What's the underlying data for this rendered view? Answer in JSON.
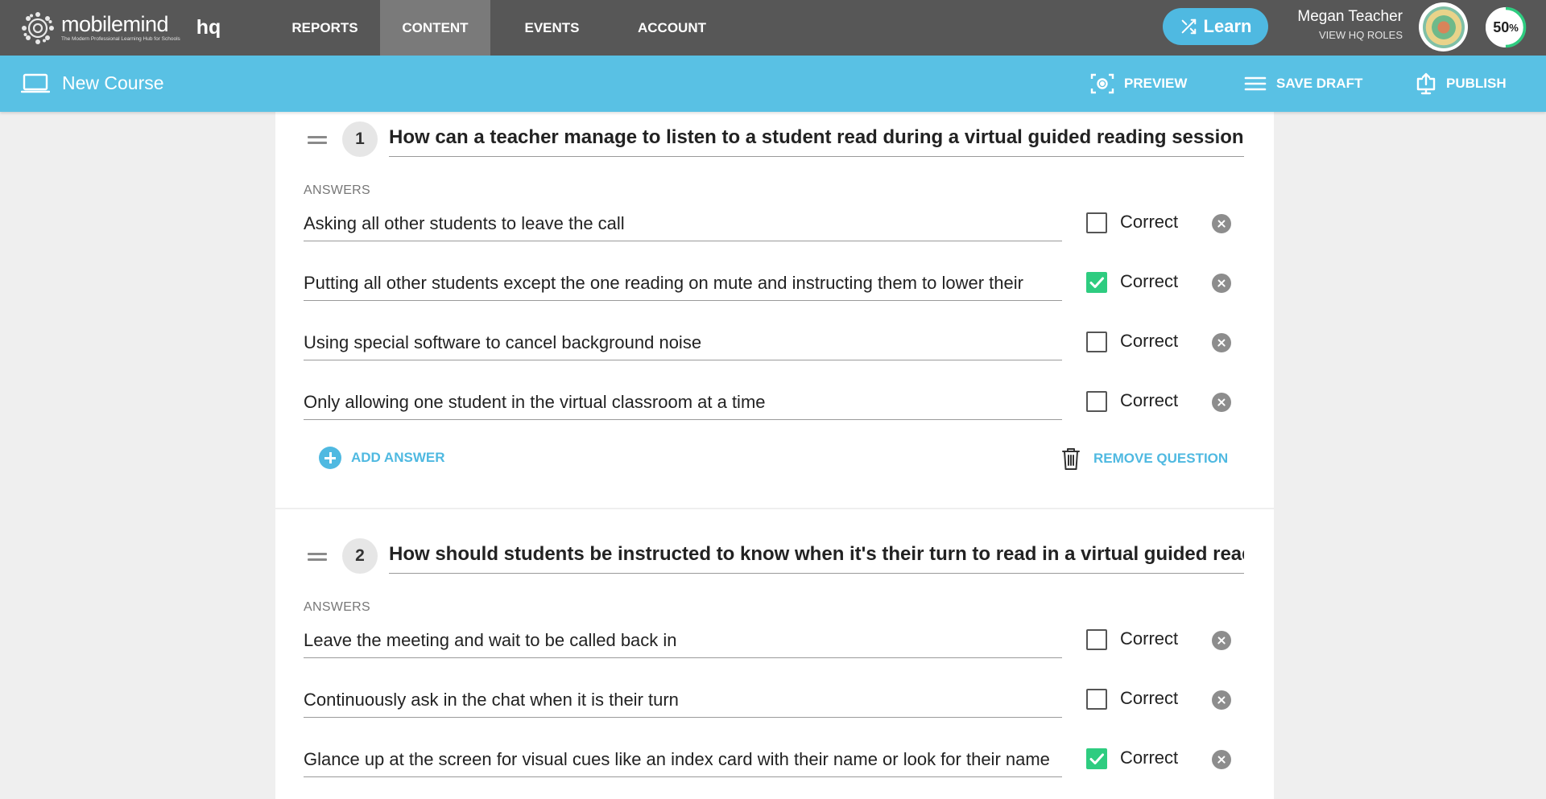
{
  "brand": {
    "name": "mobilemind",
    "tagline": "The Modern Professional Learning Hub for Schools",
    "product": "hq"
  },
  "nav": {
    "items": [
      {
        "label": "REPORTS",
        "active": false
      },
      {
        "label": "CONTENT",
        "active": true
      },
      {
        "label": "EVENTS",
        "active": false
      },
      {
        "label": "ACCOUNT",
        "active": false
      }
    ]
  },
  "header": {
    "learn_label": "Learn",
    "user_name": "Megan Teacher",
    "roles_link": "VIEW HQ ROLES",
    "progress_value": "50",
    "progress_unit": "%",
    "progress_fraction": 0.5
  },
  "course_bar": {
    "title": "New Course",
    "preview_label": "PREVIEW",
    "save_draft_label": "SAVE DRAFT",
    "publish_label": "PUBLISH"
  },
  "questions": [
    {
      "number": "1",
      "text": "How can a teacher manage to listen to a student read during a virtual guided reading session?",
      "answers_label": "ANSWERS",
      "answers": [
        {
          "text": "Asking all other students to leave the call",
          "correct": false,
          "correct_label": "Correct"
        },
        {
          "text": "Putting all other students except the one reading on mute and instructing them to lower their",
          "correct": true,
          "correct_label": "Correct"
        },
        {
          "text": "Using special software to cancel background noise",
          "correct": false,
          "correct_label": "Correct"
        },
        {
          "text": "Only allowing one student in the virtual classroom at a time",
          "correct": false,
          "correct_label": "Correct"
        }
      ],
      "add_answer_label": "ADD ANSWER",
      "remove_question_label": "REMOVE QUESTION"
    },
    {
      "number": "2",
      "text": "How should students be instructed to know when it's their turn to read in a virtual guided reading session?",
      "answers_label": "ANSWERS",
      "answers": [
        {
          "text": "Leave the meeting and wait to be called back in",
          "correct": false,
          "correct_label": "Correct"
        },
        {
          "text": "Continuously ask in the chat when it is their turn",
          "correct": false,
          "correct_label": "Correct"
        },
        {
          "text": "Glance up at the screen for visual cues like an index card with their name or look for their name",
          "correct": true,
          "correct_label": "Correct"
        }
      ]
    }
  ],
  "colors": {
    "topnav_bg": "#575757",
    "nav_active_bg": "#7a7a7a",
    "accent_blue": "#59c1e4",
    "button_blue": "#4fb9e1",
    "check_green": "#2ecc80",
    "page_bg": "#efefef"
  },
  "icons": {
    "logo": "mobilemind-gear-logo",
    "learn": "shuffle-icon",
    "course": "laptop-icon",
    "preview": "eye-scan-icon",
    "save_draft": "menu-lines-icon",
    "publish": "upload-monitor-icon",
    "add": "plus-circle-icon",
    "remove_question": "trash-icon",
    "remove_answer": "close-circle-icon",
    "drag": "drag-handle-icon",
    "checked": "checkmark-icon"
  }
}
